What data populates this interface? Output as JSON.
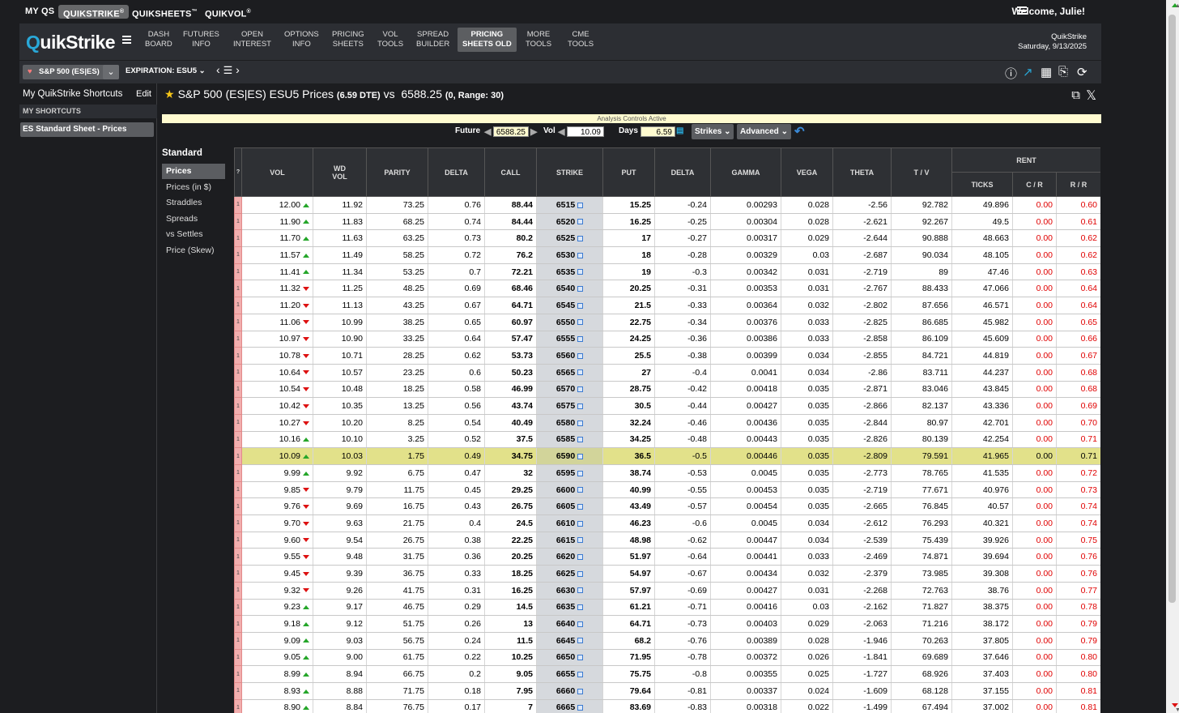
{
  "topbar": {
    "tabs": [
      {
        "label": "MY QS"
      },
      {
        "label": "QUIKSTRIKE",
        "sup": "®"
      },
      {
        "label": "QUIKSHEETS",
        "sup": "™"
      },
      {
        "label": "QUIKVOL",
        "sup": "®"
      }
    ],
    "welcome": "Welcome, Julie!"
  },
  "nav": {
    "logo_a": "Q",
    "logo_b": "uikStrike",
    "items": [
      {
        "label": "DASH\nBOARD"
      },
      {
        "label": "FUTURES\nINFO"
      },
      {
        "label": "OPEN\nINTEREST"
      },
      {
        "label": "OPTIONS\nINFO"
      },
      {
        "label": "PRICING\nSHEETS"
      },
      {
        "label": "VOL\nTOOLS"
      },
      {
        "label": "SPREAD\nBUILDER"
      },
      {
        "label": "PRICING\nSHEETS OLD"
      },
      {
        "label": "MORE\nTOOLS"
      },
      {
        "label": "CME\nTOOLS"
      }
    ],
    "brand": "QuikStrike",
    "date": "Saturday, 9/13/2025"
  },
  "toolbar": {
    "symbol": "S&P 500 (ES|ES)",
    "expiration_label": "EXPIRATION:",
    "expiration": "ESU5"
  },
  "sidebar": {
    "title": "My QuikStrike Shortcuts",
    "edit": "Edit",
    "section": "MY SHORTCUTS",
    "item": "ES Standard Sheet - Prices"
  },
  "page": {
    "title": "S&P 500 (ES|ES) ESU5 Prices",
    "dte": "(6.59 DTE)",
    "vs": "vs",
    "price": "6588.25",
    "range": "(0,  Range: 30)",
    "analysis": "Analysis Controls Active"
  },
  "controls": {
    "future_label": "Future",
    "future": "6588.25",
    "vol_label": "Vol",
    "vol": "10.09",
    "days_label": "Days",
    "days": "6.59",
    "strikes": "Strikes",
    "advanced": "Advanced"
  },
  "left_nav": {
    "heading": "Standard",
    "items": [
      "Prices",
      "Prices (in $)",
      "Straddles",
      "Spreads",
      "vs Settles",
      "Price (Skew)"
    ]
  },
  "table": {
    "headers": {
      "q": "?",
      "vol": "VOL",
      "wdvol": "WD VOL",
      "parity": "PARITY",
      "delta": "DELTA",
      "call": "CALL",
      "strike": "STRIKE",
      "put": "PUT",
      "pdelta": "DELTA",
      "gamma": "GAMMA",
      "vega": "VEGA",
      "theta": "THETA",
      "tv": "T / V",
      "rent": "RENT",
      "ticks": "TICKS",
      "cr": "C / R",
      "rr": "R / R"
    },
    "rows": [
      [
        "1",
        "12.00",
        "u",
        "11.92",
        "73.25",
        "0.76",
        "88.44",
        "6515",
        "15.25",
        "-0.24",
        "0.00293",
        "0.028",
        "-2.56",
        "92.782",
        "49.896",
        "0.00",
        "0.60"
      ],
      [
        "1",
        "11.90",
        "u",
        "11.83",
        "68.25",
        "0.74",
        "84.44",
        "6520",
        "16.25",
        "-0.25",
        "0.00304",
        "0.028",
        "-2.621",
        "92.267",
        "49.5",
        "0.00",
        "0.61"
      ],
      [
        "1",
        "11.70",
        "u",
        "11.63",
        "63.25",
        "0.73",
        "80.2",
        "6525",
        "17",
        "-0.27",
        "0.00317",
        "0.029",
        "-2.644",
        "90.888",
        "48.663",
        "0.00",
        "0.62"
      ],
      [
        "1",
        "11.57",
        "u",
        "11.49",
        "58.25",
        "0.72",
        "76.2",
        "6530",
        "18",
        "-0.28",
        "0.00329",
        "0.03",
        "-2.687",
        "90.034",
        "48.105",
        "0.00",
        "0.62"
      ],
      [
        "1",
        "11.41",
        "u",
        "11.34",
        "53.25",
        "0.7",
        "72.21",
        "6535",
        "19",
        "-0.3",
        "0.00342",
        "0.031",
        "-2.719",
        "89",
        "47.46",
        "0.00",
        "0.63"
      ],
      [
        "1",
        "11.32",
        "d",
        "11.25",
        "48.25",
        "0.69",
        "68.46",
        "6540",
        "20.25",
        "-0.31",
        "0.00353",
        "0.031",
        "-2.767",
        "88.433",
        "47.066",
        "0.00",
        "0.64"
      ],
      [
        "1",
        "11.20",
        "d",
        "11.13",
        "43.25",
        "0.67",
        "64.71",
        "6545",
        "21.5",
        "-0.33",
        "0.00364",
        "0.032",
        "-2.802",
        "87.656",
        "46.571",
        "0.00",
        "0.64"
      ],
      [
        "1",
        "11.06",
        "d",
        "10.99",
        "38.25",
        "0.65",
        "60.97",
        "6550",
        "22.75",
        "-0.34",
        "0.00376",
        "0.033",
        "-2.825",
        "86.685",
        "45.982",
        "0.00",
        "0.65"
      ],
      [
        "1",
        "10.97",
        "d",
        "10.90",
        "33.25",
        "0.64",
        "57.47",
        "6555",
        "24.25",
        "-0.36",
        "0.00386",
        "0.033",
        "-2.858",
        "86.109",
        "45.609",
        "0.00",
        "0.66"
      ],
      [
        "1",
        "10.78",
        "d",
        "10.71",
        "28.25",
        "0.62",
        "53.73",
        "6560",
        "25.5",
        "-0.38",
        "0.00399",
        "0.034",
        "-2.855",
        "84.721",
        "44.819",
        "0.00",
        "0.67"
      ],
      [
        "1",
        "10.64",
        "d",
        "10.57",
        "23.25",
        "0.6",
        "50.23",
        "6565",
        "27",
        "-0.4",
        "0.0041",
        "0.034",
        "-2.86",
        "83.711",
        "44.237",
        "0.00",
        "0.68"
      ],
      [
        "1",
        "10.54",
        "d",
        "10.48",
        "18.25",
        "0.58",
        "46.99",
        "6570",
        "28.75",
        "-0.42",
        "0.00418",
        "0.035",
        "-2.871",
        "83.046",
        "43.845",
        "0.00",
        "0.68"
      ],
      [
        "1",
        "10.42",
        "d",
        "10.35",
        "13.25",
        "0.56",
        "43.74",
        "6575",
        "30.5",
        "-0.44",
        "0.00427",
        "0.035",
        "-2.866",
        "82.137",
        "43.336",
        "0.00",
        "0.69"
      ],
      [
        "1",
        "10.27",
        "d",
        "10.20",
        "8.25",
        "0.54",
        "40.49",
        "6580",
        "32.24",
        "-0.46",
        "0.00436",
        "0.035",
        "-2.844",
        "80.97",
        "42.701",
        "0.00",
        "0.70"
      ],
      [
        "1",
        "10.16",
        "u",
        "10.10",
        "3.25",
        "0.52",
        "37.5",
        "6585",
        "34.25",
        "-0.48",
        "0.00443",
        "0.035",
        "-2.826",
        "80.139",
        "42.254",
        "0.00",
        "0.71"
      ],
      [
        "1",
        "10.09",
        "u",
        "10.03",
        "1.75",
        "0.49",
        "34.75",
        "6590",
        "36.5",
        "-0.5",
        "0.00446",
        "0.035",
        "-2.809",
        "79.591",
        "41.965",
        "0.00",
        "0.71"
      ],
      [
        "1",
        "9.99",
        "u",
        "9.92",
        "6.75",
        "0.47",
        "32",
        "6595",
        "38.74",
        "-0.53",
        "0.0045",
        "0.035",
        "-2.773",
        "78.765",
        "41.535",
        "0.00",
        "0.72"
      ],
      [
        "1",
        "9.85",
        "d",
        "9.79",
        "11.75",
        "0.45",
        "29.25",
        "6600",
        "40.99",
        "-0.55",
        "0.00453",
        "0.035",
        "-2.719",
        "77.671",
        "40.976",
        "0.00",
        "0.73"
      ],
      [
        "1",
        "9.76",
        "d",
        "9.69",
        "16.75",
        "0.43",
        "26.75",
        "6605",
        "43.49",
        "-0.57",
        "0.00454",
        "0.035",
        "-2.665",
        "76.845",
        "40.57",
        "0.00",
        "0.74"
      ],
      [
        "1",
        "9.70",
        "d",
        "9.63",
        "21.75",
        "0.4",
        "24.5",
        "6610",
        "46.23",
        "-0.6",
        "0.0045",
        "0.034",
        "-2.612",
        "76.293",
        "40.321",
        "0.00",
        "0.74"
      ],
      [
        "1",
        "9.60",
        "d",
        "9.54",
        "26.75",
        "0.38",
        "22.25",
        "6615",
        "48.98",
        "-0.62",
        "0.00447",
        "0.034",
        "-2.539",
        "75.439",
        "39.926",
        "0.00",
        "0.75"
      ],
      [
        "1",
        "9.55",
        "d",
        "9.48",
        "31.75",
        "0.36",
        "20.25",
        "6620",
        "51.97",
        "-0.64",
        "0.00441",
        "0.033",
        "-2.469",
        "74.871",
        "39.694",
        "0.00",
        "0.76"
      ],
      [
        "1",
        "9.45",
        "d",
        "9.39",
        "36.75",
        "0.33",
        "18.25",
        "6625",
        "54.97",
        "-0.67",
        "0.00434",
        "0.032",
        "-2.379",
        "73.985",
        "39.308",
        "0.00",
        "0.76"
      ],
      [
        "1",
        "9.32",
        "d",
        "9.26",
        "41.75",
        "0.31",
        "16.25",
        "6630",
        "57.97",
        "-0.69",
        "0.00427",
        "0.031",
        "-2.268",
        "72.763",
        "38.76",
        "0.00",
        "0.77"
      ],
      [
        "1",
        "9.23",
        "u",
        "9.17",
        "46.75",
        "0.29",
        "14.5",
        "6635",
        "61.21",
        "-0.71",
        "0.00416",
        "0.03",
        "-2.162",
        "71.827",
        "38.375",
        "0.00",
        "0.78"
      ],
      [
        "1",
        "9.18",
        "u",
        "9.12",
        "51.75",
        "0.26",
        "13",
        "6640",
        "64.71",
        "-0.73",
        "0.00403",
        "0.029",
        "-2.063",
        "71.216",
        "38.172",
        "0.00",
        "0.79"
      ],
      [
        "1",
        "9.09",
        "u",
        "9.03",
        "56.75",
        "0.24",
        "11.5",
        "6645",
        "68.2",
        "-0.76",
        "0.00389",
        "0.028",
        "-1.946",
        "70.263",
        "37.805",
        "0.00",
        "0.79"
      ],
      [
        "1",
        "9.05",
        "u",
        "9.00",
        "61.75",
        "0.22",
        "10.25",
        "6650",
        "71.95",
        "-0.78",
        "0.00372",
        "0.026",
        "-1.841",
        "69.689",
        "37.646",
        "0.00",
        "0.80"
      ],
      [
        "1",
        "8.99",
        "u",
        "8.94",
        "66.75",
        "0.2",
        "9.05",
        "6655",
        "75.75",
        "-0.8",
        "0.00355",
        "0.025",
        "-1.727",
        "68.926",
        "37.403",
        "0.00",
        "0.80"
      ],
      [
        "1",
        "8.93",
        "u",
        "8.88",
        "71.75",
        "0.18",
        "7.95",
        "6660",
        "79.64",
        "-0.81",
        "0.00337",
        "0.024",
        "-1.609",
        "68.128",
        "37.155",
        "0.00",
        "0.81"
      ],
      [
        "1",
        "8.90",
        "u",
        "8.84",
        "76.75",
        "0.17",
        "7",
        "6665",
        "83.69",
        "-0.83",
        "0.00318",
        "0.022",
        "-1.499",
        "67.494",
        "37.002",
        "0.00",
        "0.81"
      ]
    ],
    "atm_strike": "6590"
  }
}
